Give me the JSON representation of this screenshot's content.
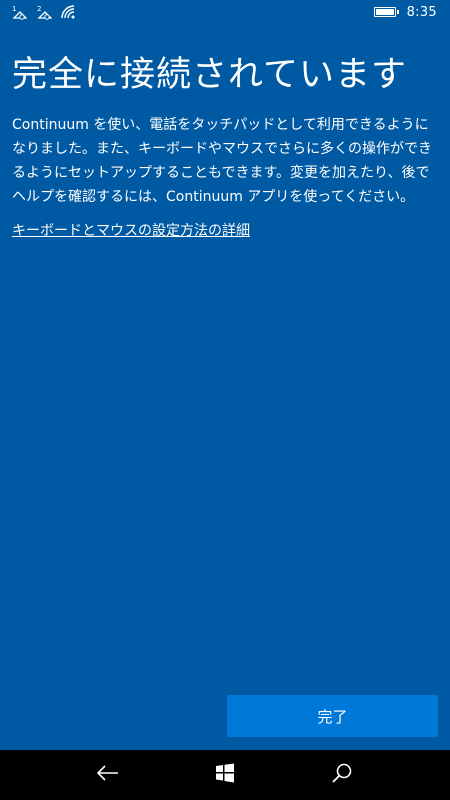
{
  "status_bar": {
    "time": "8:35",
    "icons": [
      "sim1-no-signal-icon",
      "sim2-no-signal-icon",
      "wifi-icon",
      "battery-icon"
    ]
  },
  "page": {
    "title": "完全に接続されています",
    "description": "Continuum を使い、電話をタッチパッドとして利用できるようになりました。また、キーボードやマウスでさらに多くの操作ができるようにセットアップすることもできます。変更を加えたり、後でヘルプを確認するには、Continuum アプリを使ってください。",
    "help_link": "キーボードとマウスの設定方法の詳細"
  },
  "actions": {
    "done_label": "完了"
  },
  "nav_bar": {
    "items": [
      "back-icon",
      "windows-start-icon",
      "search-icon"
    ]
  },
  "colors": {
    "background": "#005aa3",
    "button": "#0078d7",
    "nav_bar": "#000000",
    "text": "#ffffff"
  }
}
